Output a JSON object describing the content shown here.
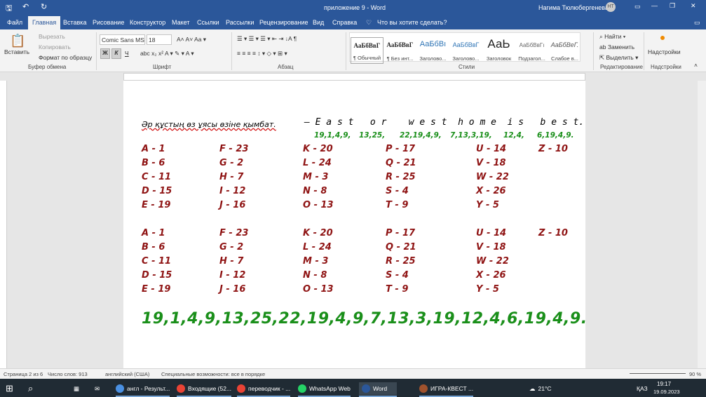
{
  "title": {
    "doc": "приложение 9  -  Word",
    "user": "Нагима Тюлюбергенева",
    "initials": "НТ"
  },
  "tabs": [
    "Файл",
    "Главная",
    "Вставка",
    "Рисование",
    "Конструктор",
    "Макет",
    "Ссылки",
    "Рассылки",
    "Рецензирование",
    "Вид",
    "Справка"
  ],
  "tell_me": "Что вы хотите сделать?",
  "clipboard": {
    "paste": "Вставить",
    "cut": "Вырезать",
    "copy": "Копировать",
    "format": "Формат по образцу",
    "group": "Буфер обмена"
  },
  "font": {
    "name": "Comic Sans MS",
    "size": "18",
    "group": "Шрифт",
    "bold": "Ж",
    "italic": "К",
    "underline": "Ч"
  },
  "paragraph": {
    "group": "Абзац"
  },
  "styles": {
    "group": "Стили",
    "items": [
      {
        "sample": "АаБбВвГ",
        "label": "¶ Обычный"
      },
      {
        "sample": "АаБбВвГ",
        "label": "¶ Без инт..."
      },
      {
        "sample": "АаБбВı",
        "label": "Заголово..."
      },
      {
        "sample": "АаБбВвГ",
        "label": "Заголово..."
      },
      {
        "sample": "АаЬ",
        "label": "Заголовок"
      },
      {
        "sample": "АаБбВвГı",
        "label": "Подзагол..."
      },
      {
        "sample": "АаБбВеГ.",
        "label": "Слабое в..."
      }
    ]
  },
  "editing": {
    "find": "Найти",
    "replace": "Заменить",
    "select": "Выделить",
    "group": "Редактирование"
  },
  "addins": {
    "label": "Надстройки",
    "group": "Надстройки"
  },
  "doc": {
    "kazakh": "Әр құстың өз ұясы өзіне қымбат.",
    "english": "– E a s t   o r    w e s t  h o m e  i s   b e s t.",
    "codes": [
      "19,1,4,9,",
      "13,25,",
      "22,19,4,9,",
      "7,13,3,19,",
      "12,4,",
      "6,19,4,9."
    ],
    "table": [
      [
        "A - 1",
        "F - 23",
        "K - 20",
        "P - 17",
        "U - 14",
        "Z - 10"
      ],
      [
        "B - 6",
        "G - 2",
        "L - 24",
        "Q - 21",
        "V - 18",
        ""
      ],
      [
        "C - 11",
        "H - 7",
        "M - 3",
        "R - 25",
        "W - 22",
        ""
      ],
      [
        "D - 15",
        "I - 12",
        "N - 8",
        "S - 4",
        "X - 26",
        ""
      ],
      [
        "E - 19",
        "J - 16",
        "O - 13",
        "T - 9",
        "Y - 5",
        ""
      ]
    ],
    "big": "19,1,4,9,13,25,22,19,4,9,7,13,3,19,12,4,6,19,4,9."
  },
  "status": {
    "page": "Страница 2 из 6",
    "words": "Число слов: 913",
    "lang": "английский (США)",
    "access": "Специальные возможности: все в порядке",
    "zoom": "90 %"
  },
  "taskbar": {
    "items": [
      "англ - Результ...",
      "Входящие (52...",
      "переводчик - ...",
      "WhatsApp Web",
      "Word",
      "ИГРА-КВЕСТ ..."
    ],
    "weather": "21°C",
    "lang": "ҚАЗ",
    "time": "19:17",
    "date": "19.09.2023"
  },
  "colors": {
    "accent": "#2b579a",
    "red_text": "#8f1414",
    "green_text": "#1a8f1a"
  }
}
